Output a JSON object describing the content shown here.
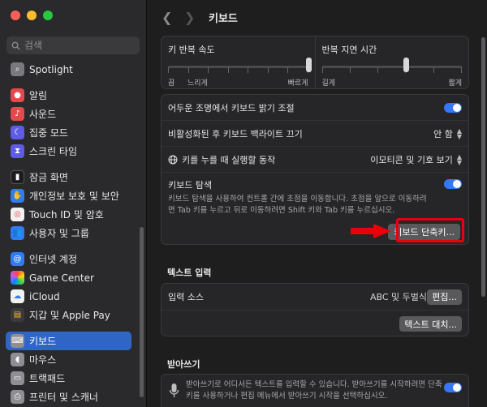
{
  "sidebar": {
    "search_placeholder": "검색",
    "items": [
      {
        "label": "Spotlight",
        "icon": "spotlight-icon",
        "color": "#7a7a7e"
      },
      {
        "label": "알림",
        "icon": "bell-icon",
        "color": "#e5484d"
      },
      {
        "label": "사운드",
        "icon": "sound-icon",
        "color": "#e5484d"
      },
      {
        "label": "집중 모드",
        "icon": "moon-icon",
        "color": "#5e5ce6"
      },
      {
        "label": "스크린 타임",
        "icon": "hourglass-icon",
        "color": "#5e5ce6"
      },
      {
        "label": "잠금 화면",
        "icon": "lock-screen-icon",
        "color": "#1c1c1e"
      },
      {
        "label": "개인정보 보호 및 보안",
        "icon": "hand-icon",
        "color": "#2f7cf6"
      },
      {
        "label": "Touch ID 및 암호",
        "icon": "fingerprint-icon",
        "color": "#f2f2f2"
      },
      {
        "label": "사용자 및 그룹",
        "icon": "users-icon",
        "color": "#2f7cf6"
      },
      {
        "label": "인터넷 계정",
        "icon": "at-icon",
        "color": "#2f7cf6"
      },
      {
        "label": "Game Center",
        "icon": "game-center-icon",
        "color": "#f2f2f2"
      },
      {
        "label": "iCloud",
        "icon": "cloud-icon",
        "color": "#f2f2f2"
      },
      {
        "label": "지갑 및 Apple Pay",
        "icon": "wallet-icon",
        "color": "#3a3a3c"
      },
      {
        "label": "키보드",
        "icon": "keyboard-icon",
        "color": "#8e8e93"
      },
      {
        "label": "마우스",
        "icon": "mouse-icon",
        "color": "#8e8e93"
      },
      {
        "label": "트랙패드",
        "icon": "trackpad-icon",
        "color": "#8e8e93"
      },
      {
        "label": "프린터 및 스캐너",
        "icon": "printer-icon",
        "color": "#8e8e93"
      }
    ]
  },
  "header": {
    "title": "키보드"
  },
  "repeat": {
    "key_repeat_label": "키 반복 속도",
    "key_repeat_min": "끔",
    "key_repeat_mid": "느리게",
    "key_repeat_max": "빠르게",
    "key_repeat_value": 1.0,
    "delay_label": "반복 지연 시간",
    "delay_min": "길게",
    "delay_max": "짧게",
    "delay_value": 0.6
  },
  "settings": {
    "backlight_label": "어두운 조명에서 키보드 밝기 조절",
    "backlight_on": true,
    "backlight_off_label": "비활성화된 후 키보드 백라이트 끄기",
    "backlight_off_value": "안 함",
    "globe_label": "키를 누를 때 실행할 동작",
    "globe_value": "이모티콘 및 기호 보기",
    "nav_label": "키보드 탐색",
    "nav_desc": "키보드 탐색을 사용하여 컨트롤 간에 초점을 이동합니다. 초점을 앞으로 이동하려면 Tab 키를 누르고 뒤로 이동하려면 Shift 키와 Tab 키를 누르십시오.",
    "nav_on": true,
    "shortcuts_button": "키보드 단축키..."
  },
  "text_input": {
    "section": "텍스트 입력",
    "source_label": "입력 소스",
    "source_value": "ABC 및 두벌식",
    "edit_button": "편집...",
    "replace_button": "텍스트 대치..."
  },
  "dictation": {
    "section": "받아쓰기",
    "desc": "받아쓰기로 어디서든 텍스트를 입력할 수 있습니다. 받아쓰기를 시작하려면 단축키를 사용하거나 편집 메뉴에서 받아쓰기 시작을 선택하십시오.",
    "on": true
  },
  "colors": {
    "accent": "#3478f6",
    "highlight": "#e8000b",
    "active": "#2f66c6"
  }
}
